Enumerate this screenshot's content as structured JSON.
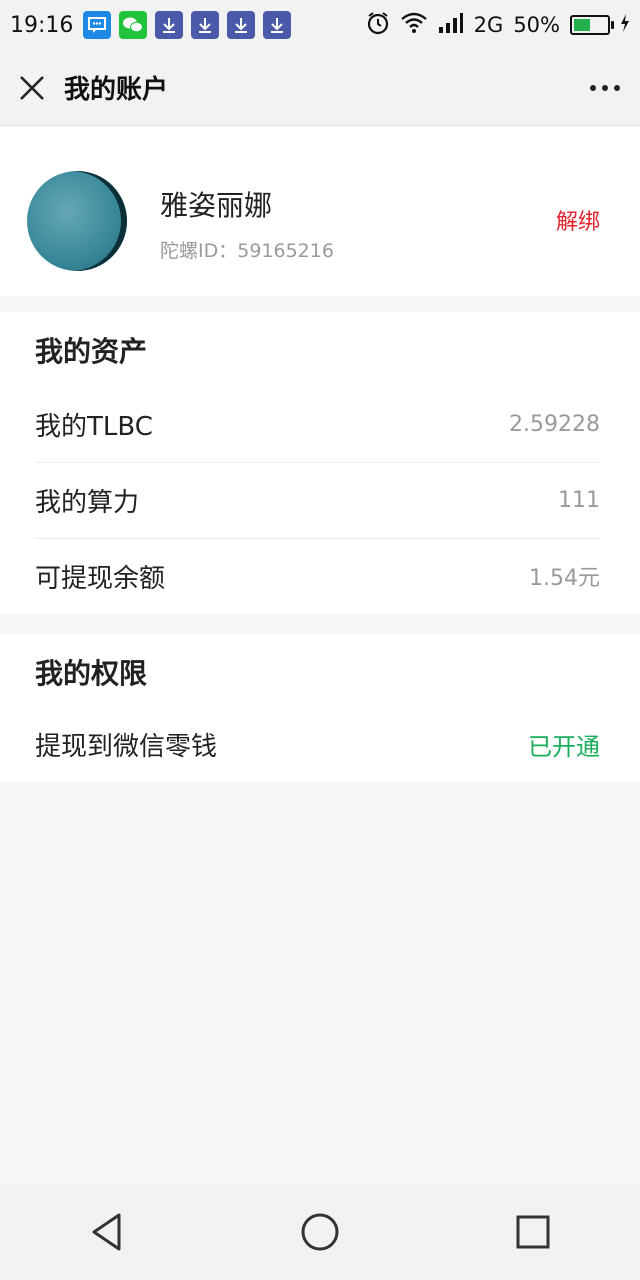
{
  "status_bar": {
    "time": "19:16",
    "network": "2G",
    "battery": "50%",
    "battery_level": 0.5,
    "icons": [
      "message-icon",
      "wechat-icon",
      "download-icon",
      "download-icon",
      "download-icon",
      "download-icon",
      "alarm-icon",
      "wifi-icon",
      "signal-icon",
      "battery-icon"
    ]
  },
  "header": {
    "title": "我的账户"
  },
  "account": {
    "name": "雅姿丽娜",
    "id_label": "陀螺ID：",
    "id_value": "59165216",
    "unbind_label": "解绑"
  },
  "assets": {
    "title": "我的资产",
    "rows": [
      {
        "label": "我的TLBC",
        "value": "2.59228"
      },
      {
        "label": "我的算力",
        "value": "111"
      },
      {
        "label": "可提现余额",
        "value": "1.54元"
      }
    ]
  },
  "permissions": {
    "title": "我的权限",
    "rows": [
      {
        "label": "提现到微信零钱",
        "value": "已开通"
      }
    ]
  },
  "colors": {
    "accent_red": "#e0212b",
    "accent_green": "#1aad5b",
    "background": "#f6f6f6"
  }
}
